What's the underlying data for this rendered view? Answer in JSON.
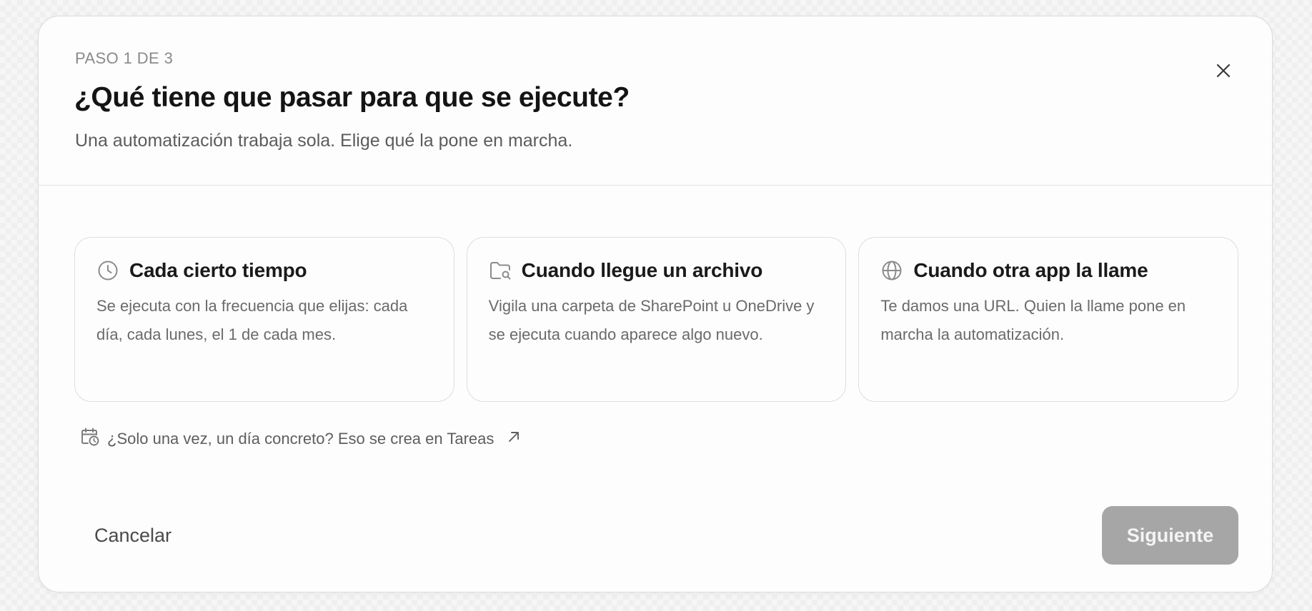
{
  "dialog": {
    "step_label": "PASO 1 DE 3",
    "title": "¿Qué tiene que pasar para que se ejecute?",
    "subtitle": "Una automatización trabaja sola. Elige qué la pone en marcha.",
    "close_icon": "close-icon"
  },
  "triggers": [
    {
      "icon": "clock-icon",
      "title": "Cada cierto tiempo",
      "description": "Se ejecuta con la frecuencia que elijas: cada día, cada lunes, el 1 de cada mes."
    },
    {
      "icon": "folder-search-icon",
      "title": "Cuando llegue un archivo",
      "description": "Vigila una carpeta de SharePoint u OneDrive y se ejecuta cuando aparece algo nuevo."
    },
    {
      "icon": "globe-icon",
      "title": "Cuando otra app la llame",
      "description": "Te damos una URL. Quien la llame pone en marcha la automatización."
    }
  ],
  "tasks_link": {
    "icon": "calendar-clock-icon",
    "text": "¿Solo una vez, un día concreto? Eso se crea en Tareas",
    "trailing_icon": "arrow-up-right-icon"
  },
  "footer": {
    "cancel_label": "Cancelar",
    "next_label": "Siguiente",
    "next_state": "disabled"
  },
  "colors": {
    "dialog_background": "#fdfdfd",
    "border": "#dedede",
    "next_button_disabled": "#a6a6a6",
    "muted_text": "#6a6a6a"
  }
}
